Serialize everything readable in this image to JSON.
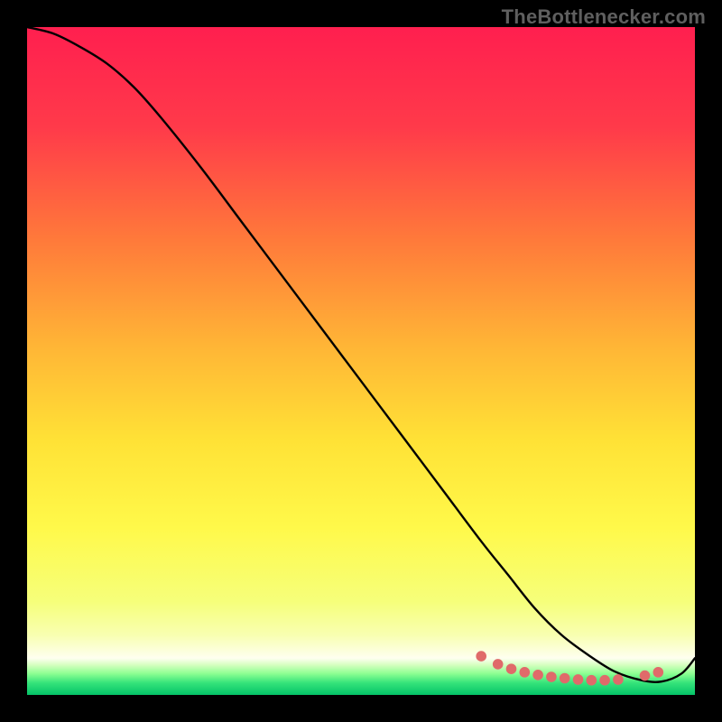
{
  "watermark": "TheBottlenecker.com",
  "chart_data": {
    "type": "line",
    "title": "",
    "xlabel": "",
    "ylabel": "",
    "xlim": [
      0,
      100
    ],
    "ylim": [
      0,
      100
    ],
    "grid": false,
    "legend": false,
    "background_gradient_stops": [
      {
        "offset": 0.0,
        "color": "#ff1f4f"
      },
      {
        "offset": 0.15,
        "color": "#ff3a4a"
      },
      {
        "offset": 0.32,
        "color": "#ff7a3a"
      },
      {
        "offset": 0.48,
        "color": "#ffb636"
      },
      {
        "offset": 0.62,
        "color": "#ffe236"
      },
      {
        "offset": 0.75,
        "color": "#fff94a"
      },
      {
        "offset": 0.86,
        "color": "#f6ff7a"
      },
      {
        "offset": 0.91,
        "color": "#f8ffb0"
      },
      {
        "offset": 0.945,
        "color": "#fefff0"
      },
      {
        "offset": 0.955,
        "color": "#d6ffc0"
      },
      {
        "offset": 0.968,
        "color": "#8dff92"
      },
      {
        "offset": 0.982,
        "color": "#35e37a"
      },
      {
        "offset": 1.0,
        "color": "#04c368"
      }
    ],
    "series": [
      {
        "name": "bottleneck-curve",
        "color": "#000000",
        "stroke_width": 2.4,
        "x": [
          0,
          4,
          8,
          12,
          16,
          20,
          26,
          32,
          38,
          44,
          50,
          56,
          62,
          68,
          72,
          76,
          80,
          84,
          88,
          92,
          95,
          98,
          100
        ],
        "y": [
          100,
          99,
          97,
          94.5,
          91,
          86.5,
          79,
          71,
          63,
          55,
          47,
          39,
          31,
          23,
          18,
          13,
          9,
          6,
          3.5,
          2.2,
          2.0,
          3.2,
          5.5
        ]
      }
    ],
    "markers": {
      "name": "near-zero-dots",
      "color": "#e06a6a",
      "radius": 5.8,
      "points": [
        {
          "x": 68.0,
          "y": 5.8
        },
        {
          "x": 70.5,
          "y": 4.6
        },
        {
          "x": 72.5,
          "y": 3.9
        },
        {
          "x": 74.5,
          "y": 3.4
        },
        {
          "x": 76.5,
          "y": 3.0
        },
        {
          "x": 78.5,
          "y": 2.7
        },
        {
          "x": 80.5,
          "y": 2.5
        },
        {
          "x": 82.5,
          "y": 2.3
        },
        {
          "x": 84.5,
          "y": 2.2
        },
        {
          "x": 86.5,
          "y": 2.2
        },
        {
          "x": 88.5,
          "y": 2.3
        },
        {
          "x": 92.5,
          "y": 2.9
        },
        {
          "x": 94.5,
          "y": 3.4
        }
      ]
    }
  }
}
